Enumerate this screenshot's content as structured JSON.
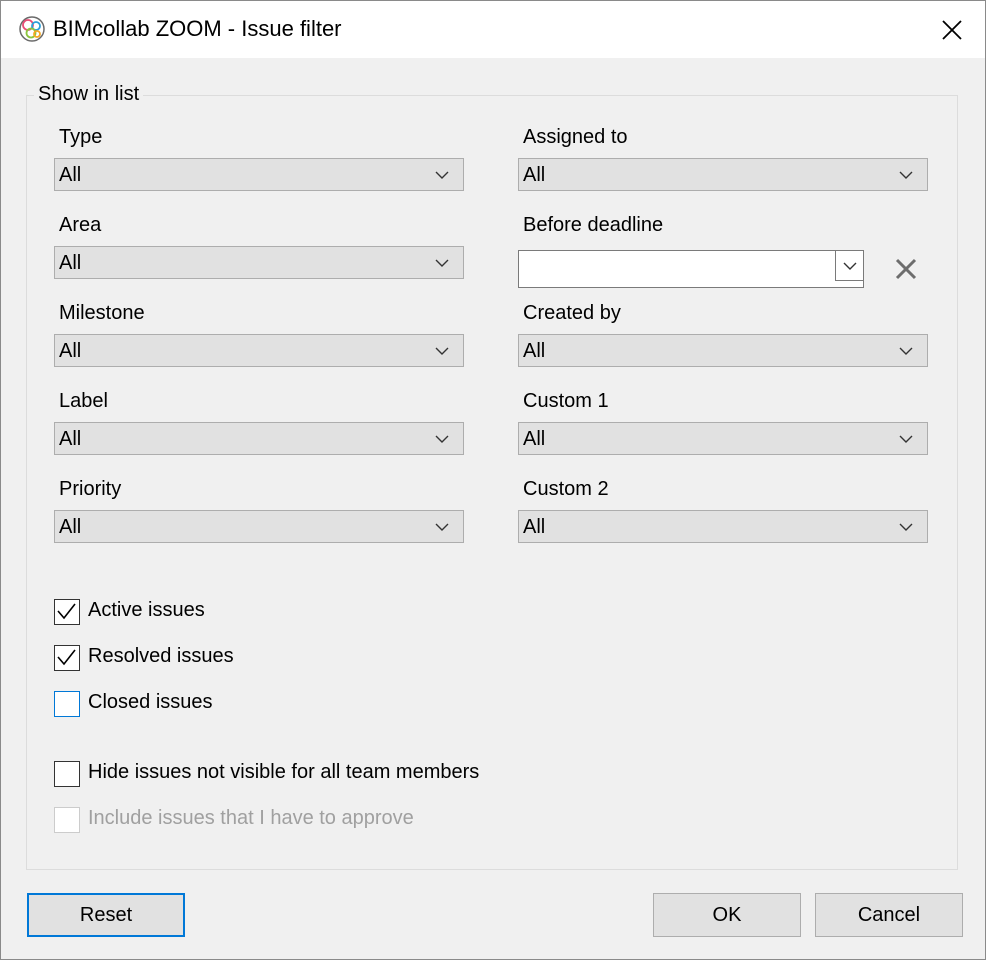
{
  "window": {
    "title": "BIMcollab ZOOM - Issue filter"
  },
  "group": {
    "label": "Show in list"
  },
  "fields": {
    "type": {
      "label": "Type",
      "value": "All"
    },
    "assigned_to": {
      "label": "Assigned to",
      "value": "All"
    },
    "area": {
      "label": "Area",
      "value": "All"
    },
    "before_deadline": {
      "label": "Before deadline",
      "value": ""
    },
    "milestone": {
      "label": "Milestone",
      "value": "All"
    },
    "created_by": {
      "label": "Created by",
      "value": "All"
    },
    "label": {
      "label": "Label",
      "value": "All"
    },
    "custom1": {
      "label": "Custom 1",
      "value": "All"
    },
    "priority": {
      "label": "Priority",
      "value": "All"
    },
    "custom2": {
      "label": "Custom 2",
      "value": "All"
    }
  },
  "checkboxes": {
    "active": {
      "label": "Active issues",
      "checked": true
    },
    "resolved": {
      "label": "Resolved issues",
      "checked": true
    },
    "closed": {
      "label": "Closed issues",
      "checked": false
    },
    "hide_not_visible": {
      "label": "Hide issues not visible for all team members",
      "checked": false
    },
    "include_approve": {
      "label": "Include issues that I have to approve",
      "checked": false,
      "disabled": true
    }
  },
  "buttons": {
    "reset": "Reset",
    "ok": "OK",
    "cancel": "Cancel"
  },
  "icons": {
    "app": "bimcollab-app-icon",
    "close": "close-icon",
    "dropdown": "chevron-down-icon",
    "clear": "clear-x-icon",
    "check": "checkmark-icon"
  },
  "colors": {
    "accent": "#0078d7",
    "disabled_text": "#a0a0a0"
  }
}
